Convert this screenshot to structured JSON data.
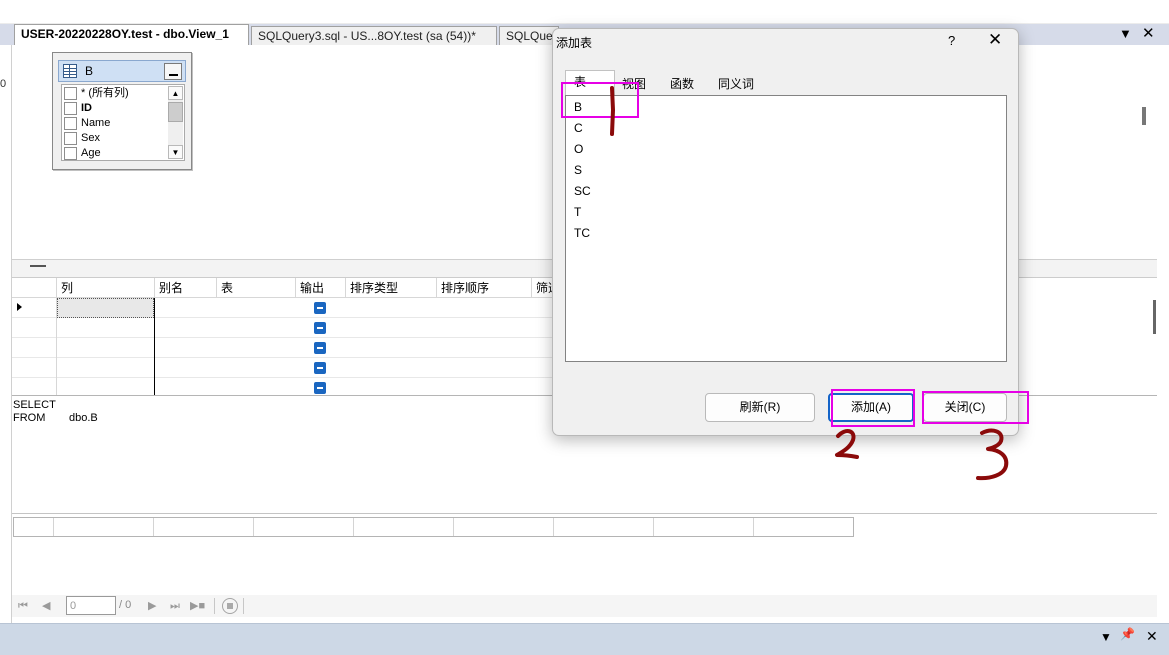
{
  "tabs": [
    {
      "label": "USER-20220228OY.test - dbo.View_1",
      "active": true
    },
    {
      "label": "SQLQuery3.sql - US...8OY.test (sa (54))*",
      "active": false
    },
    {
      "label": "SQLQue",
      "active": false
    }
  ],
  "tab_controls": {
    "dropdown": "▼",
    "close": "✕"
  },
  "left_marker": "0",
  "diagram": {
    "table": {
      "name": "B",
      "columns": [
        {
          "label": "* (所有列)",
          "key": false
        },
        {
          "label": "ID",
          "key": true
        },
        {
          "label": "Name",
          "key": false
        },
        {
          "label": "Sex",
          "key": false
        },
        {
          "label": "Age",
          "key": false
        }
      ]
    }
  },
  "criteria_grid": {
    "headers": [
      "列",
      "别名",
      "表",
      "输出",
      "排序类型",
      "排序顺序",
      "筛选"
    ],
    "row_count": 5
  },
  "sql": {
    "select_kw": "SELECT",
    "from_kw": "FROM",
    "from_value": "dbo.B"
  },
  "navigator": {
    "record_value": "0",
    "record_total": "/ 0"
  },
  "bottom_controls": {
    "dropdown": "▼",
    "pin": "📌",
    "close": "✕"
  },
  "dialog": {
    "title": "添加表",
    "help": "?",
    "close": "✕",
    "tabs": [
      "表",
      "视图",
      "函数",
      "同义词"
    ],
    "active_tab": 0,
    "items": [
      "B",
      "C",
      "O",
      "S",
      "SC",
      "T",
      "TC"
    ],
    "buttons": {
      "refresh": "刷新(R)",
      "add": "添加(A)",
      "close": "关闭(C)"
    }
  },
  "colors": {
    "highlight": "#e600e6",
    "ink": "#8b0a0a",
    "accent": "#1464c8"
  }
}
